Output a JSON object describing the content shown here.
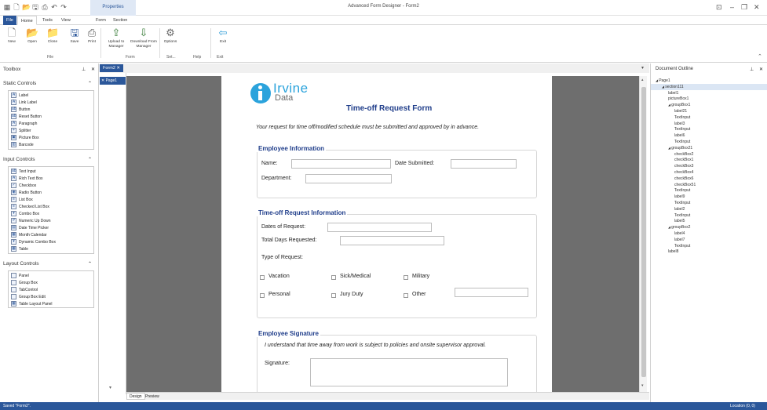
{
  "window": {
    "title": "Advanced Form Designer - Form2",
    "context_tab": "Properties"
  },
  "ribbon_tabs": [
    "File",
    "Home",
    "Tools",
    "View",
    "Form",
    "Section"
  ],
  "ribbon": {
    "buttons": [
      {
        "label": "New",
        "icon": "new-file-icon"
      },
      {
        "label": "Open",
        "icon": "open-folder-icon"
      },
      {
        "label": "Close",
        "icon": "close-folder-icon"
      },
      {
        "label": "Save",
        "icon": "save-icon"
      },
      {
        "label": "Print",
        "icon": "print-icon"
      },
      {
        "label": "Upload to Manager",
        "icon": "upload-icon"
      },
      {
        "label": "Download From Manager",
        "icon": "download-icon"
      },
      {
        "label": "Options",
        "icon": "gear-icon"
      },
      {
        "label": "Exit",
        "icon": "exit-icon"
      }
    ],
    "groups": [
      "File",
      "Form",
      "Set...",
      "Help",
      "Exit"
    ]
  },
  "toolbox": {
    "title": "Toolbox",
    "sections": [
      {
        "title": "Static Controls",
        "items": [
          "Label",
          "Link Label",
          "Button",
          "Reset Button",
          "Paragraph",
          "Splitter",
          "Picture Box",
          "Barcode"
        ]
      },
      {
        "title": "Input Controls",
        "items": [
          "Text Input",
          "Rich Text Box",
          "Checkbox",
          "Radio Button",
          "List Box",
          "Checked List Box",
          "Combo Box",
          "Numeric Up Down",
          "Date Time Picker",
          "Month Calendar",
          "Dynamic Combo Box",
          "Table"
        ]
      },
      {
        "title": "Layout Controls",
        "items": [
          "Panel",
          "Group Box",
          "TabControl",
          "Group Box Edit",
          "Table Layout Panel"
        ]
      }
    ]
  },
  "doc_tab": "Form2",
  "page_list": [
    "Page1"
  ],
  "form": {
    "logo_name": "Irvine",
    "logo_sub": "Data",
    "title": "Time-off Request Form",
    "intro": "Your request for time off/modified schedule must be submitted and approved by in advance.",
    "emp_info": {
      "title": "Employee Information",
      "name_label": "Name:",
      "date_label": "Date Submitted:",
      "dept_label": "Department:"
    },
    "timeoff": {
      "title": "Time-off Request Information",
      "dates_label": "Dates of Request:",
      "total_label": "Total Days Requested:",
      "type_label": "Type of Request:",
      "options": [
        "Vacation",
        "Sick/Medical",
        "Military",
        "Personal",
        "Jury Duty",
        "Other"
      ]
    },
    "signature": {
      "title": "Employee Signature",
      "statement": "I understand that time away from work is subject to policies and onsite supervisor approval.",
      "sig_label": "Signature:"
    }
  },
  "bottom_tabs": [
    "Design",
    "Preview"
  ],
  "outline": {
    "title": "Document Outline",
    "nodes": [
      {
        "text": "Page1",
        "level": 0,
        "expander": true
      },
      {
        "text": "section111",
        "level": 1,
        "expander": true,
        "selected": true
      },
      {
        "text": "label1",
        "level": 2
      },
      {
        "text": "pictureBox1",
        "level": 2
      },
      {
        "text": "groupBox1",
        "level": 2,
        "expander": true
      },
      {
        "text": "label21",
        "level": 3
      },
      {
        "text": "TextInput",
        "level": 3
      },
      {
        "text": "label3",
        "level": 3
      },
      {
        "text": "TextInput",
        "level": 3
      },
      {
        "text": "label6",
        "level": 3
      },
      {
        "text": "TextInput",
        "level": 3
      },
      {
        "text": "groupBox21",
        "level": 2,
        "expander": true
      },
      {
        "text": "checkBox2",
        "level": 3
      },
      {
        "text": "checkBox1",
        "level": 3
      },
      {
        "text": "checkBox3",
        "level": 3
      },
      {
        "text": "checkBox4",
        "level": 3
      },
      {
        "text": "checkBox6",
        "level": 3
      },
      {
        "text": "checkBox51",
        "level": 3
      },
      {
        "text": "TextInput",
        "level": 3
      },
      {
        "text": "label9",
        "level": 3
      },
      {
        "text": "TextInput",
        "level": 3
      },
      {
        "text": "label2",
        "level": 3
      },
      {
        "text": "TextInput",
        "level": 3
      },
      {
        "text": "label5",
        "level": 3
      },
      {
        "text": "groupBox2",
        "level": 2,
        "expander": true
      },
      {
        "text": "label4",
        "level": 3
      },
      {
        "text": "label7",
        "level": 3
      },
      {
        "text": "TextInput",
        "level": 3
      },
      {
        "text": "label8",
        "level": 2
      }
    ]
  },
  "status": {
    "left": "Saved \"Form2\".",
    "right": "Location (0, 0)"
  },
  "colors": {
    "accent": "#2b579a",
    "form_heading": "#1f3d8a",
    "canvas_bg": "#6e6e6e"
  }
}
